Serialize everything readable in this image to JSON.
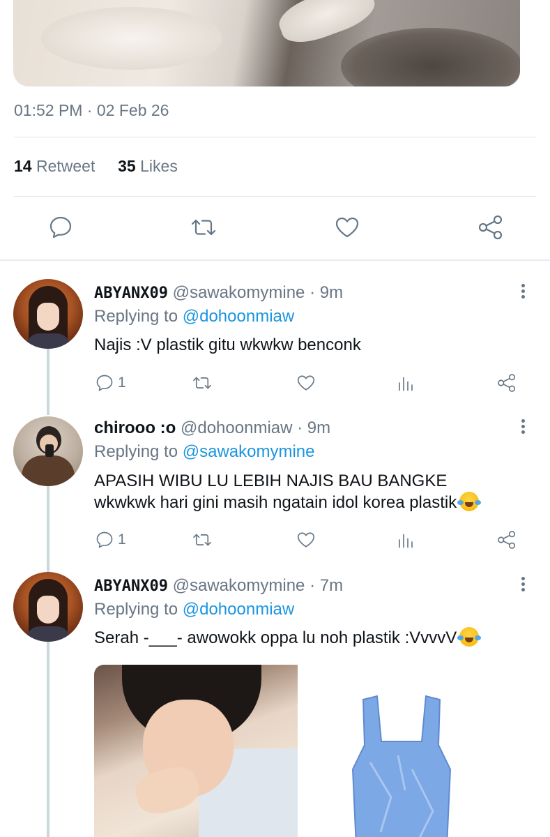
{
  "tweet": {
    "timestamp": "01:52 PM · 02 Feb 26",
    "retweets_count": "14",
    "retweets_label": "Retweet",
    "likes_count": "35",
    "likes_label": "Likes"
  },
  "main_actions": [
    "reply-icon",
    "retweet-icon",
    "like-icon",
    "share-icon"
  ],
  "replies": [
    {
      "display_name": "ABYANX09",
      "handle": "@sawakomymine",
      "time": "· 9m",
      "replying_prefix": "Replying to",
      "replying_to": "@dohoonmiaw",
      "text": "Najis :V plastik gitu wkwkw benconk",
      "reply_count": "1"
    },
    {
      "display_name": "chirooo :o",
      "handle": "@dohoonmiaw",
      "time": "· 9m",
      "replying_prefix": "Replying to",
      "replying_to": "@sawakomymine",
      "text_line1": "APASIH WIBU LU LEBIH NAJIS BAU BANGKE",
      "text_line2": "wkwkwk hari gini masih ngatain idol korea plastik",
      "reply_count": "1"
    },
    {
      "display_name": "ABYANX09",
      "handle": "@sawakomymine",
      "time": "· 7m",
      "replying_prefix": "Replying to",
      "replying_to": "@dohoonmiaw",
      "text": "Serah -___- awowokk oppa lu noh plastik :VvvvV"
    }
  ],
  "colors": {
    "link": "#1b95e0",
    "muted": "#687684",
    "text": "#0f1419"
  }
}
